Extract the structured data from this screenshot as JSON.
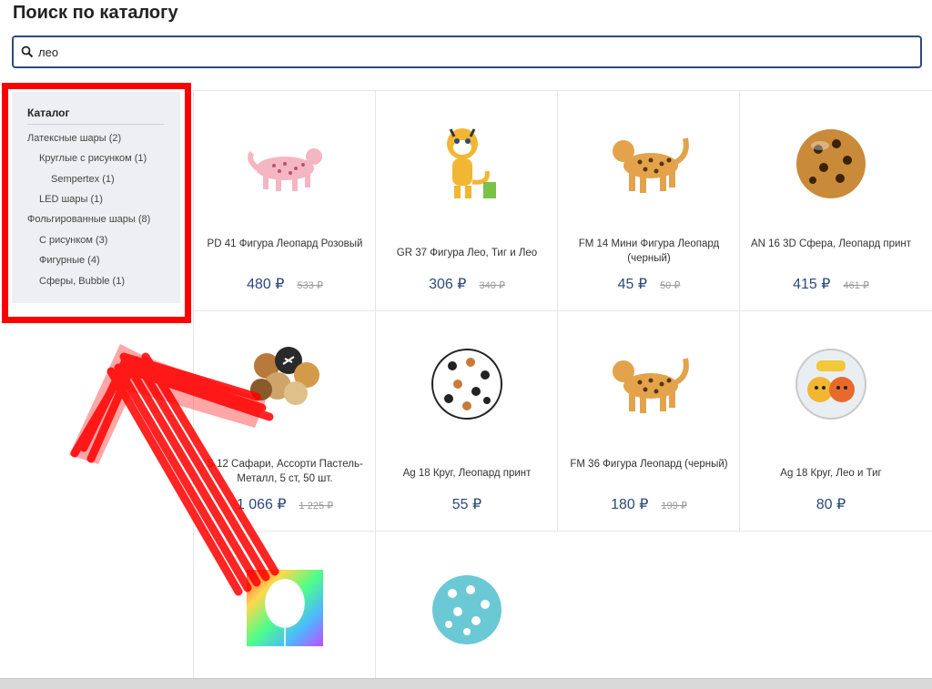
{
  "page": {
    "title": "Поиск по каталогу"
  },
  "search": {
    "value": "лео"
  },
  "sidebar": {
    "heading": "Каталог",
    "items": [
      {
        "label": "Латексные шары (2)"
      },
      {
        "label": "Круглые с рисунком (1)"
      },
      {
        "label": "Sempertex (1)"
      },
      {
        "label": "LED шары (1)"
      },
      {
        "label": "Фольгированные шары (8)"
      },
      {
        "label": "С рисунком (3)"
      },
      {
        "label": "Фигурные (4)"
      },
      {
        "label": "Сферы, Bubble (1)"
      }
    ]
  },
  "products": [
    {
      "name": "PD 41 Фигура Леопард Розовый",
      "price": "480 ₽",
      "old_price": "533 ₽",
      "image": "pink-leopard-icon"
    },
    {
      "name": "GR 37 Фигура Лео, Тиг и Лео",
      "price": "306 ₽",
      "old_price": "340 ₽",
      "image": "tiger-cub-icon"
    },
    {
      "name": "FM 14 Мини Фигура Леопард (черный)",
      "price": "45 ₽",
      "old_price": "50 ₽",
      "image": "leopard-figure-icon"
    },
    {
      "name": "AN 16 3D Сфера, Леопард принт",
      "price": "415 ₽",
      "old_price": "461 ₽",
      "image": "leopard-sphere-icon"
    },
    {
      "name": "S 12 Сафари, Ассорти Пастель-Металл, 5 ст, 50 шт.",
      "price": "1 066 ₽",
      "old_price": "1 225 ₽",
      "image": "safari-balloons-icon"
    },
    {
      "name": "Ag 18 Круг, Леопард принт",
      "price": "55 ₽",
      "old_price": "",
      "image": "leopard-circle-icon"
    },
    {
      "name": "FM 36 Фигура Леопард (черный)",
      "price": "180 ₽",
      "old_price": "199 ₽",
      "image": "leopard-figure-icon"
    },
    {
      "name": "Ag 18 Круг, Лео и Тиг",
      "price": "80 ₽",
      "old_price": "",
      "image": "leo-tig-circle-icon"
    },
    {
      "name": "",
      "price": "",
      "old_price": "",
      "image": "led-balloon-icon"
    },
    {
      "name": "",
      "price": "",
      "old_price": "",
      "image": "teal-leopard-sphere-icon"
    }
  ],
  "colors": {
    "accent": "#2b4a7a",
    "annotation": "#ff0000",
    "sidebar_bg": "#eeeff2"
  }
}
